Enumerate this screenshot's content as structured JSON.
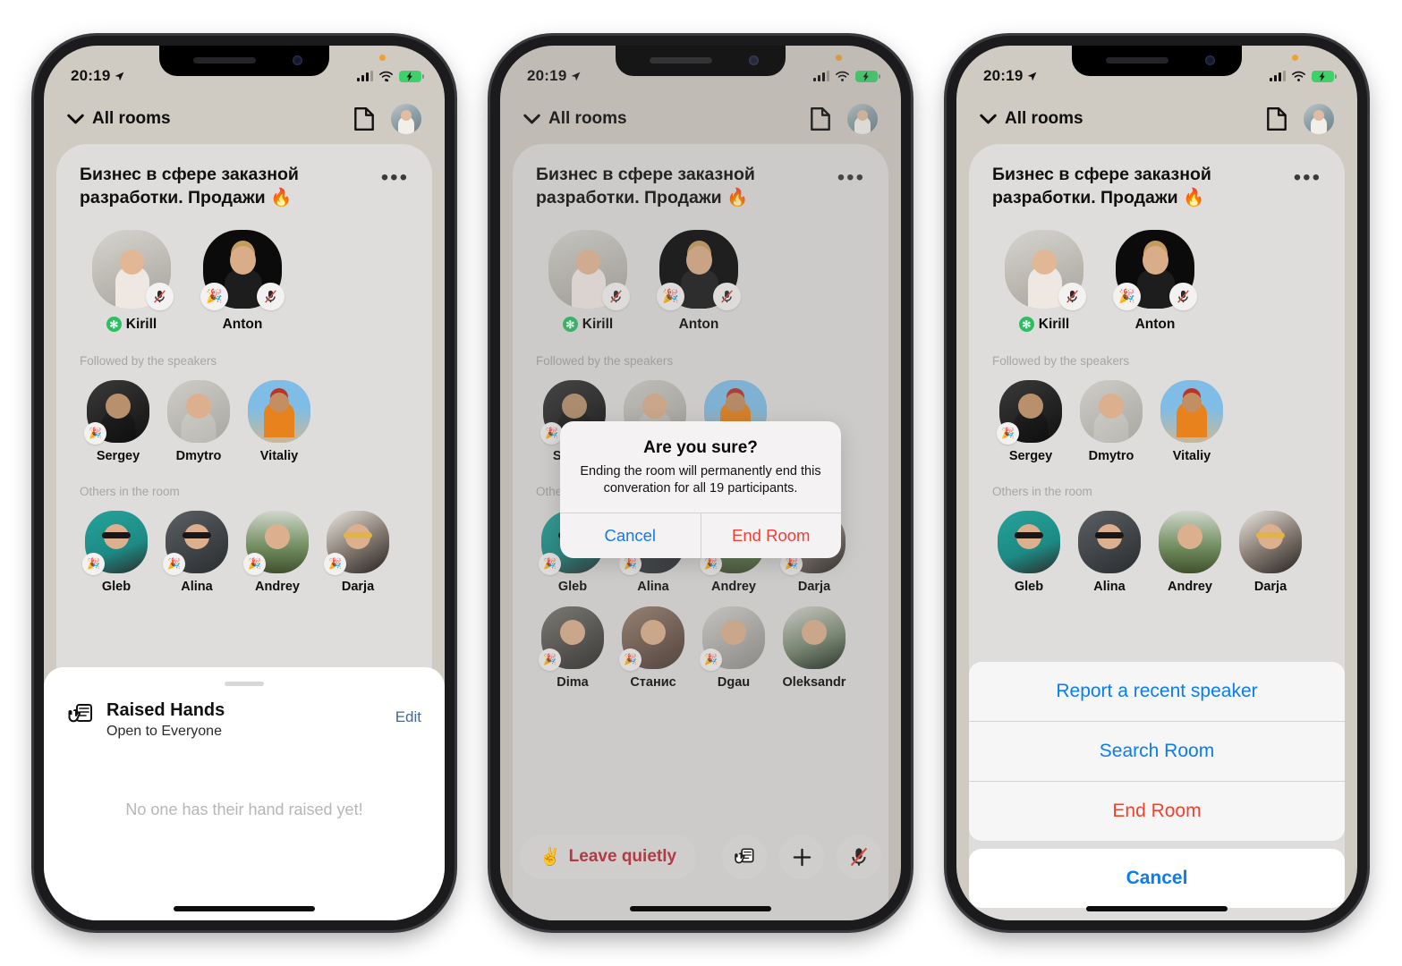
{
  "status_bar": {
    "time": "20:19",
    "location_icon": "location-arrow-icon",
    "signal_icon": "cellular-signal-icon",
    "wifi_icon": "wifi-icon",
    "battery_icon": "battery-charging-icon"
  },
  "header": {
    "back_label": "All rooms",
    "chevron_icon": "chevron-down-icon",
    "notes_icon": "document-icon",
    "avatar_icon": "user-avatar"
  },
  "room": {
    "title": "Бизнес в сфере заказной разработки. Продажи 🔥",
    "more_icon": "ellipsis-icon",
    "speakers": [
      {
        "name": "Kirill",
        "moderator_badge": "✻",
        "mic": "mic-muted-icon",
        "reaction": ""
      },
      {
        "name": "Anton",
        "moderator_badge": "",
        "mic": "mic-muted-icon",
        "reaction": "🎉"
      }
    ],
    "followed_label": "Followed by the speakers",
    "followed": [
      {
        "name": "Sergey",
        "reaction": "🎉"
      },
      {
        "name": "Dmytro",
        "reaction": ""
      },
      {
        "name": "Vitaliy",
        "reaction": ""
      }
    ],
    "others_label": "Others in the room",
    "others_row1": [
      {
        "name": "Gleb",
        "reaction": "🎉"
      },
      {
        "name": "Alina",
        "reaction": "🎉"
      },
      {
        "name": "Andrey",
        "reaction": "🎉"
      },
      {
        "name": "Darja",
        "reaction": "🎉"
      }
    ],
    "others_row2": [
      {
        "name": "Dima",
        "reaction": "🎉"
      },
      {
        "name": "Станис",
        "reaction": "🎉"
      },
      {
        "name": "Dgau",
        "reaction": "🎉"
      },
      {
        "name": "Oleksandr",
        "reaction": ""
      }
    ]
  },
  "raised_hands_sheet": {
    "icon": "raised-hand-icon",
    "title": "Raised Hands",
    "subtitle": "Open to Everyone",
    "edit_label": "Edit",
    "empty_text": "No one has their hand raised yet!"
  },
  "end_room_alert": {
    "title": "Are you sure?",
    "message": "Ending the room will permanently end this converation for all 19 participants.",
    "cancel_label": "Cancel",
    "confirm_label": "End Room"
  },
  "action_sheet": {
    "items": [
      {
        "label": "Report a recent speaker",
        "style": "default"
      },
      {
        "label": "Search Room",
        "style": "default"
      },
      {
        "label": "End Room",
        "style": "destructive"
      }
    ],
    "cancel_label": "Cancel"
  },
  "toolbar": {
    "leave_emoji": "✌️",
    "leave_label": "Leave quietly",
    "hand_icon": "raised-hand-icon",
    "add_icon": "plus-icon",
    "mic_icon": "mic-muted-icon"
  },
  "colors": {
    "header_bg": "#d0cbc2",
    "card_bg": "#dedddb",
    "ios_blue": "#0a7cf4",
    "destructive_red": "#ef4036",
    "leave_red": "#b03a45",
    "moderator_green": "#2dbd63"
  }
}
